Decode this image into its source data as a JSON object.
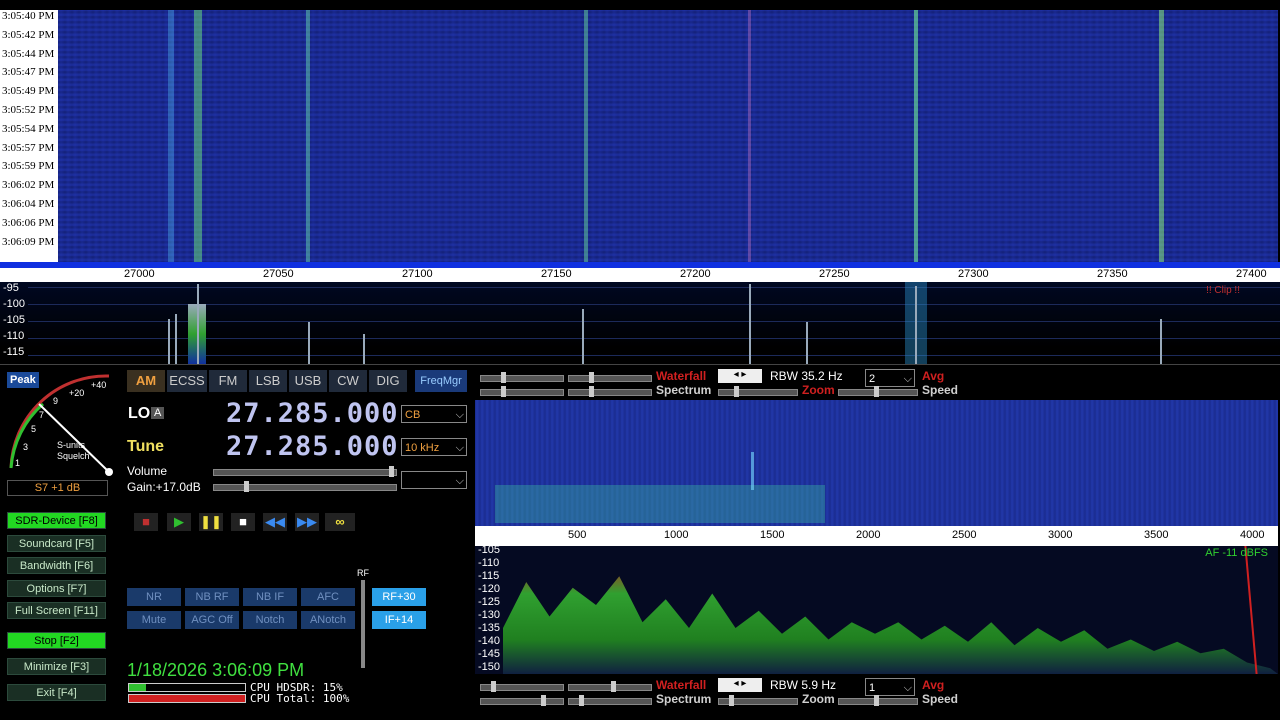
{
  "waterfall": {
    "time_labels": [
      "3:05:40 PM",
      "3:05:42 PM",
      "3:05:44 PM",
      "3:05:47 PM",
      "3:05:49 PM",
      "3:05:52 PM",
      "3:05:54 PM",
      "3:05:57 PM",
      "3:05:59 PM",
      "3:06:02 PM",
      "3:06:04 PM",
      "3:06:06 PM",
      "3:06:09 PM"
    ],
    "freq_ticks": [
      "27000",
      "27050",
      "27100",
      "27150",
      "27200",
      "27250",
      "27300",
      "27350",
      "27400"
    ]
  },
  "spectrum": {
    "db_labels": [
      "-95",
      "-100",
      "-105",
      "-110",
      "-115"
    ],
    "clip_label": "!! Clip !!"
  },
  "smeter": {
    "peak_label": "Peak",
    "scale_labels": [
      "1",
      "3",
      "5",
      "7",
      "9",
      "+20",
      "+40"
    ],
    "s_units_label": "S-units",
    "squelch_label": "Squelch",
    "reading": "S7 +1 dB"
  },
  "left_buttons": {
    "sdr_device": "SDR-Device [F8]",
    "soundcard": "Soundcard [F5]",
    "bandwidth": "Bandwidth [F6]",
    "options": "Options   [F7]",
    "full_screen": "Full Screen [F11]",
    "stop": "Stop       [F2]",
    "minimize": "Minimize [F3]",
    "exit": "Exit       [F4]"
  },
  "modes": [
    "AM",
    "ECSS",
    "FM",
    "LSB",
    "USB",
    "CW",
    "DIG"
  ],
  "freqmgr": "FreqMgr",
  "lo": {
    "label": "LO",
    "badge": "A",
    "freq": "27.285.000",
    "band": "CB"
  },
  "tune": {
    "label": "Tune",
    "freq": "27.285.000",
    "step": "10 kHz"
  },
  "volume_label": "Volume",
  "gain_label": "Gain:+17.0dB",
  "transport": [
    "■",
    "▶",
    "❚❚",
    "■",
    "◀◀",
    "▶▶",
    "∞"
  ],
  "dsp_buttons": {
    "row1": [
      "NR",
      "NB RF",
      "NB IF",
      "AFC"
    ],
    "row2": [
      "Mute",
      "AGC Off",
      "Notch",
      "ANotch"
    ],
    "rf_label": "RF",
    "rf_btn": "RF+30",
    "if_btn": "IF+14"
  },
  "datetime": "1/18/2026 3:06:09 PM",
  "cpu": {
    "hdsdr": "CPU HDSDR: 15%",
    "total": "CPU Total: 100%"
  },
  "top_controls": {
    "waterfall": "Waterfall",
    "spectrum": "Spectrum",
    "rbw": "RBW 35.2 Hz",
    "avg_value": "2",
    "avg": "Avg",
    "zoom": "Zoom",
    "speed": "Speed"
  },
  "af": {
    "ticks": [
      "500",
      "1000",
      "1500",
      "2000",
      "2500",
      "3000",
      "3500",
      "4000"
    ],
    "db_labels": [
      "-105",
      "-110",
      "-115",
      "-120",
      "-125",
      "-130",
      "-135",
      "-140",
      "-145",
      "-150"
    ],
    "level": "AF -11 dBFS"
  },
  "bottom_controls": {
    "waterfall": "Waterfall",
    "spectrum": "Spectrum",
    "rbw": "RBW  5.9 Hz",
    "avg_value": "1",
    "avg": "Avg",
    "zoom": "Zoom",
    "speed": "Speed"
  }
}
